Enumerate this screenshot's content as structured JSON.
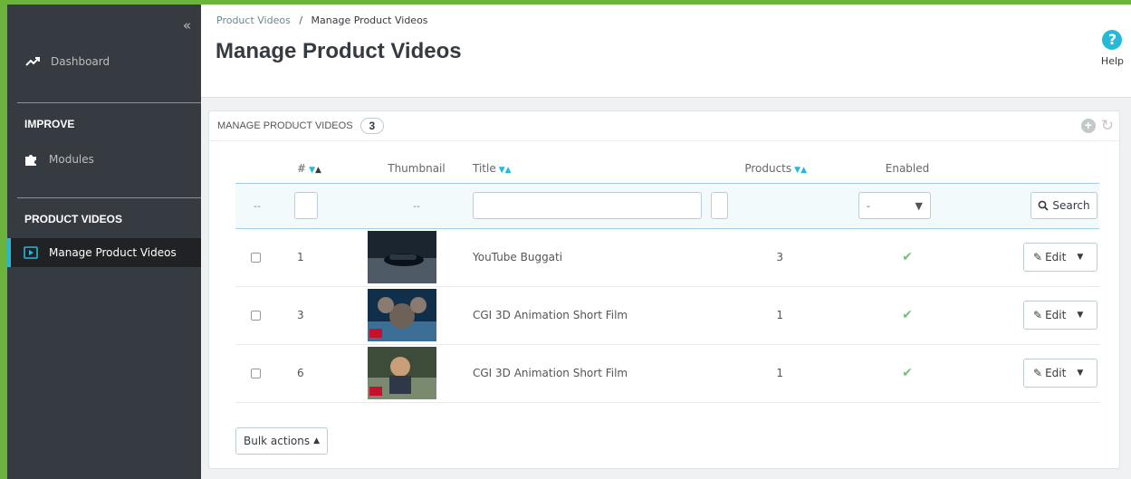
{
  "sidebar": {
    "collapse_label": "«",
    "dashboard_label": "Dashboard",
    "section_improve": "IMPROVE",
    "modules_label": "Modules",
    "section_product_videos": "PRODUCT VIDEOS",
    "manage_label": "Manage Product Videos"
  },
  "header": {
    "breadcrumb_parent": "Product Videos",
    "breadcrumb_sep": "/",
    "breadcrumb_current": "Manage Product Videos",
    "title": "Manage Product Videos",
    "help_label": "Help"
  },
  "panel": {
    "title": "Manage Product Videos",
    "count": "3"
  },
  "table": {
    "columns": {
      "id": "#",
      "thumbnail": "Thumbnail",
      "title": "Title",
      "products": "Products",
      "enabled": "Enabled"
    },
    "filter": {
      "first_placeholder": "--",
      "thumb_placeholder": "--",
      "enabled_value": "-",
      "search_label": "Search"
    },
    "rows": [
      {
        "id": "1",
        "title": "YouTube Buggati",
        "products": "3",
        "enabled": "✔",
        "edit": "Edit",
        "thumb_colors": [
          "#1a2530",
          "#4d5a66"
        ]
      },
      {
        "id": "3",
        "title": "CGI 3D Animation Short Film",
        "products": "1",
        "enabled": "✔",
        "edit": "Edit",
        "thumb_colors": [
          "#0f2f4a",
          "#3d6f96"
        ]
      },
      {
        "id": "6",
        "title": "CGI 3D Animation Short Film",
        "products": "1",
        "enabled": "✔",
        "edit": "Edit",
        "thumb_colors": [
          "#3c4c38",
          "#7a8a6e"
        ]
      }
    ],
    "bulk_label": "Bulk actions"
  },
  "colors": {
    "accent": "#25b9d7",
    "sidebar_bg": "#363a41",
    "frame_green": "#6cb33e",
    "check_green": "#72c279"
  }
}
